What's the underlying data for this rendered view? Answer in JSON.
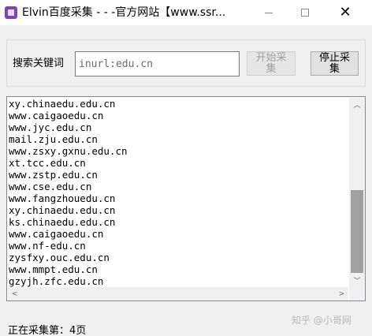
{
  "window": {
    "title": "Elvin百度采集 - - -官方网站【www.ssr...",
    "minimize_glyph": "",
    "maximize_glyph": "",
    "close_glyph": "✕"
  },
  "search": {
    "label": "搜索关键词",
    "value": "inurl:edu.cn",
    "start_label": "开始采集",
    "stop_label": "停止采集"
  },
  "results": [
    "xy.chinaedu.edu.cn",
    "www.caigaoedu.cn",
    "www.jyc.edu.cn",
    "mail.zju.edu.cn",
    "www.zsxy.gxnu.edu.cn",
    "xt.tcc.edu.cn",
    "www.zstp.edu.cn",
    "www.cse.edu.cn",
    "www.fangzhouedu.cn",
    "xy.chinaedu.edu.cn",
    "ks.chinaedu.edu.cn",
    "www.caigaoedu.cn",
    "www.nf-edu.cn",
    "zysfxy.ouc.edu.cn",
    "www.mmpt.edu.cn",
    "gzyjh.zfc.edu.cn"
  ],
  "scroll": {
    "up": "︿",
    "down": "﹀",
    "left": "<",
    "right": ">"
  },
  "status": {
    "text": "正在采集第：4页"
  },
  "watermark": {
    "text": "知乎 @小哥网"
  }
}
